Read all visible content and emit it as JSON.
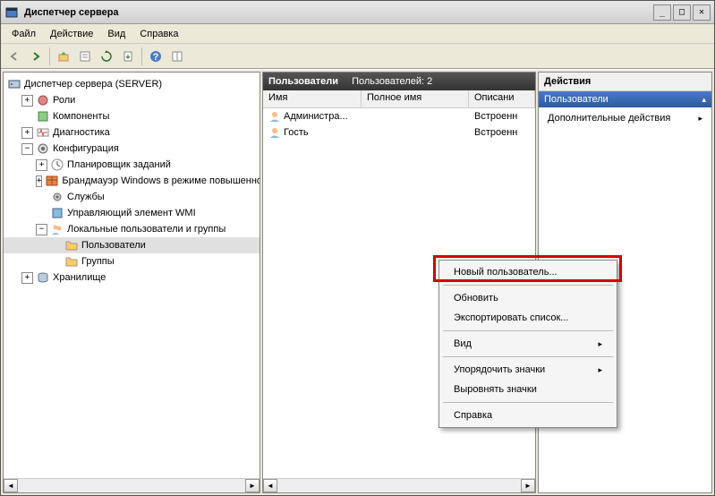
{
  "window": {
    "title": "Диспетчер сервера"
  },
  "menu": {
    "file": "Файл",
    "action": "Действие",
    "view": "Вид",
    "help": "Справка"
  },
  "tree": {
    "root": "Диспетчер сервера (SERVER)",
    "roles": "Роли",
    "components": "Компоненты",
    "diagnostics": "Диагностика",
    "config": "Конфигурация",
    "scheduler": "Планировщик заданий",
    "firewall": "Брандмауэр Windows в режиме повышенно",
    "services": "Службы",
    "wmi": "Управляющий элемент WMI",
    "lusers": "Локальные пользователи и группы",
    "users": "Пользователи",
    "groups": "Группы",
    "storage": "Хранилище"
  },
  "list": {
    "title_a": "Пользователи",
    "title_b": "Пользователей: 2",
    "col_name": "Имя",
    "col_full": "Полное имя",
    "col_desc": "Описани",
    "rows": [
      {
        "name": "Администра...",
        "full": "",
        "desc": "Встроенн"
      },
      {
        "name": "Гость",
        "full": "",
        "desc": "Встроенн"
      }
    ]
  },
  "actions": {
    "header": "Действия",
    "sub": "Пользователи",
    "more": "Дополнительные действия"
  },
  "context": {
    "new_user": "Новый пользователь...",
    "refresh": "Обновить",
    "export": "Экспортировать список...",
    "view": "Вид",
    "arrange": "Упорядочить значки",
    "align": "Выровнять значки",
    "help": "Справка"
  }
}
